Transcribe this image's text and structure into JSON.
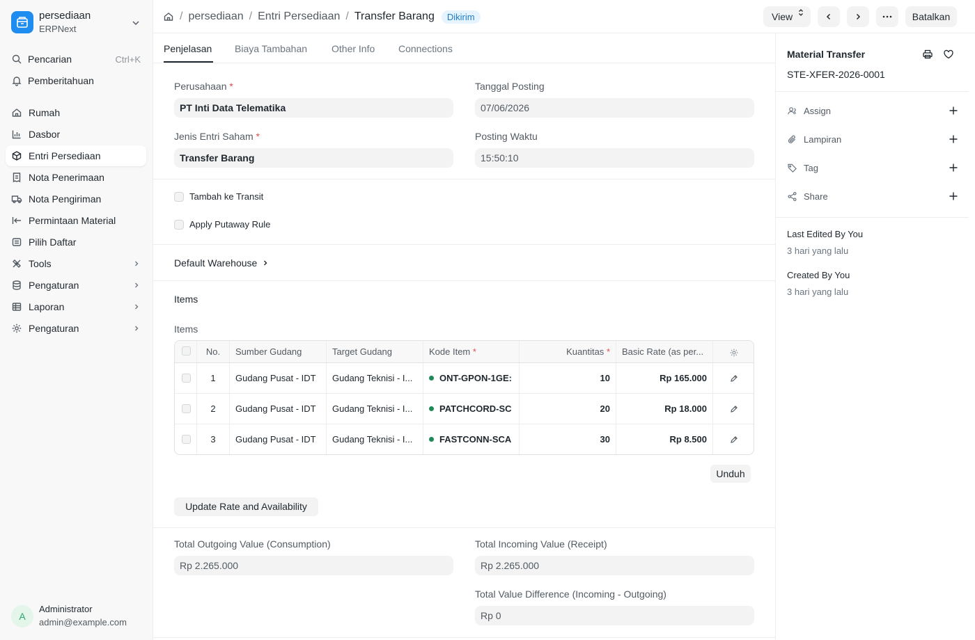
{
  "workspace": {
    "title": "persediaan",
    "subtitle": "ERPNext"
  },
  "sidebar": {
    "search": {
      "label": "Pencarian",
      "shortcut": "Ctrl+K"
    },
    "notifications": {
      "label": "Pemberitahuan"
    },
    "items": [
      {
        "label": "Rumah",
        "icon": "home-icon"
      },
      {
        "label": "Dasbor",
        "icon": "chart-icon"
      },
      {
        "label": "Entri Persediaan",
        "icon": "box-icon",
        "active": true
      },
      {
        "label": "Nota Penerimaan",
        "icon": "receipt-icon"
      },
      {
        "label": "Nota Pengiriman",
        "icon": "truck-icon"
      },
      {
        "label": "Permintaan Material",
        "icon": "arrow-left-bar-icon"
      },
      {
        "label": "Pilih Daftar",
        "icon": "list-icon"
      },
      {
        "label": "Tools",
        "icon": "tools-icon",
        "expandable": true
      },
      {
        "label": "Pengaturan",
        "icon": "database-icon",
        "expandable": true
      },
      {
        "label": "Laporan",
        "icon": "table-icon",
        "expandable": true
      },
      {
        "label": "Pengaturan",
        "icon": "gear-icon",
        "expandable": true
      }
    ]
  },
  "user": {
    "initial": "A",
    "name": "Administrator",
    "email": "admin@example.com"
  },
  "breadcrumb": {
    "items": [
      "persediaan",
      "Entri Persediaan"
    ],
    "current": "Transfer Barang",
    "status": "Dikirim"
  },
  "toolbar": {
    "view_label": "View",
    "cancel_label": "Batalkan"
  },
  "tabs": [
    "Penjelasan",
    "Biaya Tambahan",
    "Other Info",
    "Connections"
  ],
  "form": {
    "company_label": "Perusahaan",
    "company_value": "PT Inti Data Telematika",
    "posting_date_label": "Tanggal Posting",
    "posting_date_value": "07/06/2026",
    "entry_type_label": "Jenis Entri Saham",
    "entry_type_value": "Transfer Barang",
    "posting_time_label": "Posting Waktu",
    "posting_time_value": "15:50:10",
    "add_to_transit_label": "Tambah ke Transit",
    "apply_putaway_label": "Apply Putaway Rule",
    "default_warehouse_label": "Default Warehouse",
    "items_section_label": "Items",
    "items_table_label": "Items",
    "download_label": "Unduh",
    "update_rate_label": "Update Rate and Availability",
    "total_outgoing_label": "Total Outgoing Value (Consumption)",
    "total_outgoing_value": "Rp 2.265.000",
    "total_incoming_label": "Total Incoming Value (Receipt)",
    "total_incoming_value": "Rp 2.265.000",
    "value_diff_label": "Total Value Difference (Incoming - Outgoing)",
    "value_diff_value": "Rp 0"
  },
  "items_table": {
    "columns": [
      "No.",
      "Sumber Gudang",
      "Target Gudang",
      "Kode Item",
      "Kuantitas",
      "Basic Rate (as per..."
    ],
    "rows": [
      {
        "no": "1",
        "source": "Gudang Pusat - IDT",
        "target": "Gudang Teknisi - I...",
        "item_code": "ONT-GPON-1GE:",
        "qty": "10",
        "rate": "Rp 165.000"
      },
      {
        "no": "2",
        "source": "Gudang Pusat - IDT",
        "target": "Gudang Teknisi - I...",
        "item_code": "PATCHCORD-SC",
        "qty": "20",
        "rate": "Rp 18.000"
      },
      {
        "no": "3",
        "source": "Gudang Pusat - IDT",
        "target": "Gudang Teknisi - I...",
        "item_code": "FASTCONN-SCA",
        "qty": "30",
        "rate": "Rp 8.500"
      }
    ]
  },
  "right_panel": {
    "doctype": "Material Transfer",
    "doc_name": "STE-XFER-2026-0001",
    "actions": [
      {
        "label": "Assign",
        "icon": "user-icon"
      },
      {
        "label": "Lampiran",
        "icon": "paperclip-icon"
      },
      {
        "label": "Tag",
        "icon": "tag-icon"
      },
      {
        "label": "Share",
        "icon": "share-icon"
      }
    ],
    "last_edited_label": "Last Edited By You",
    "last_edited_value": "3 hari yang lalu",
    "created_label": "Created By You",
    "created_value": "3 hari yang lalu"
  },
  "colors": {
    "accent": "#1f8df0",
    "status_badge_bg": "#e6f4ff",
    "status_badge_text": "#1e7bc8",
    "item_dot": "#1e8a55",
    "required": "#e24c4c"
  }
}
